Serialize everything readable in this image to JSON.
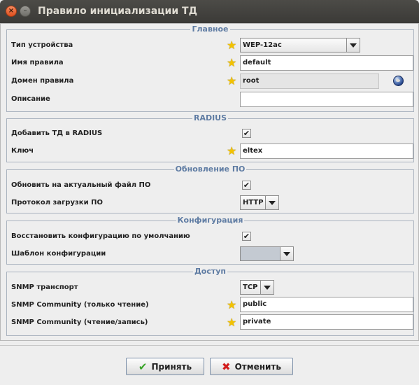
{
  "window": {
    "title": "Правило инициализации ТД"
  },
  "main": {
    "title": "Главное",
    "device_type_label": "Тип устройства",
    "device_type_value": "WEP-12ac",
    "rule_name_label": "Имя правила",
    "rule_name_value": "default",
    "rule_domain_label": "Домен правила",
    "rule_domain_value": "root",
    "description_label": "Описание",
    "description_value": ""
  },
  "radius": {
    "title": "RADIUS",
    "add_ap_label": "Добавить ТД в RADIUS",
    "add_ap_checked": true,
    "key_label": "Ключ",
    "key_value": "eltex"
  },
  "firmware": {
    "title": "Обновление ПО",
    "update_label": "Обновить на актуальный файл ПО",
    "update_checked": true,
    "protocol_label": "Протокол загрузки ПО",
    "protocol_value": "HTTP"
  },
  "config": {
    "title": "Конфигурация",
    "restore_label": "Восстановить конфигурацию по умолчанию",
    "restore_checked": true,
    "template_label": "Шаблон конфигурации",
    "template_value": ""
  },
  "access": {
    "title": "Доступ",
    "snmp_transport_label": "SNMP транспорт",
    "snmp_transport_value": "TCP",
    "snmp_ro_label": "SNMP Community (только чтение)",
    "snmp_ro_value": "public",
    "snmp_rw_label": "SNMP Community (чтение/запись)",
    "snmp_rw_value": "private"
  },
  "buttons": {
    "ok_label": "Принять",
    "cancel_label": "Отменить"
  },
  "icons": {
    "required": "star-icon",
    "domain_picker": "globe-icon",
    "ok": "checkmark-icon",
    "cancel": "cross-icon"
  }
}
